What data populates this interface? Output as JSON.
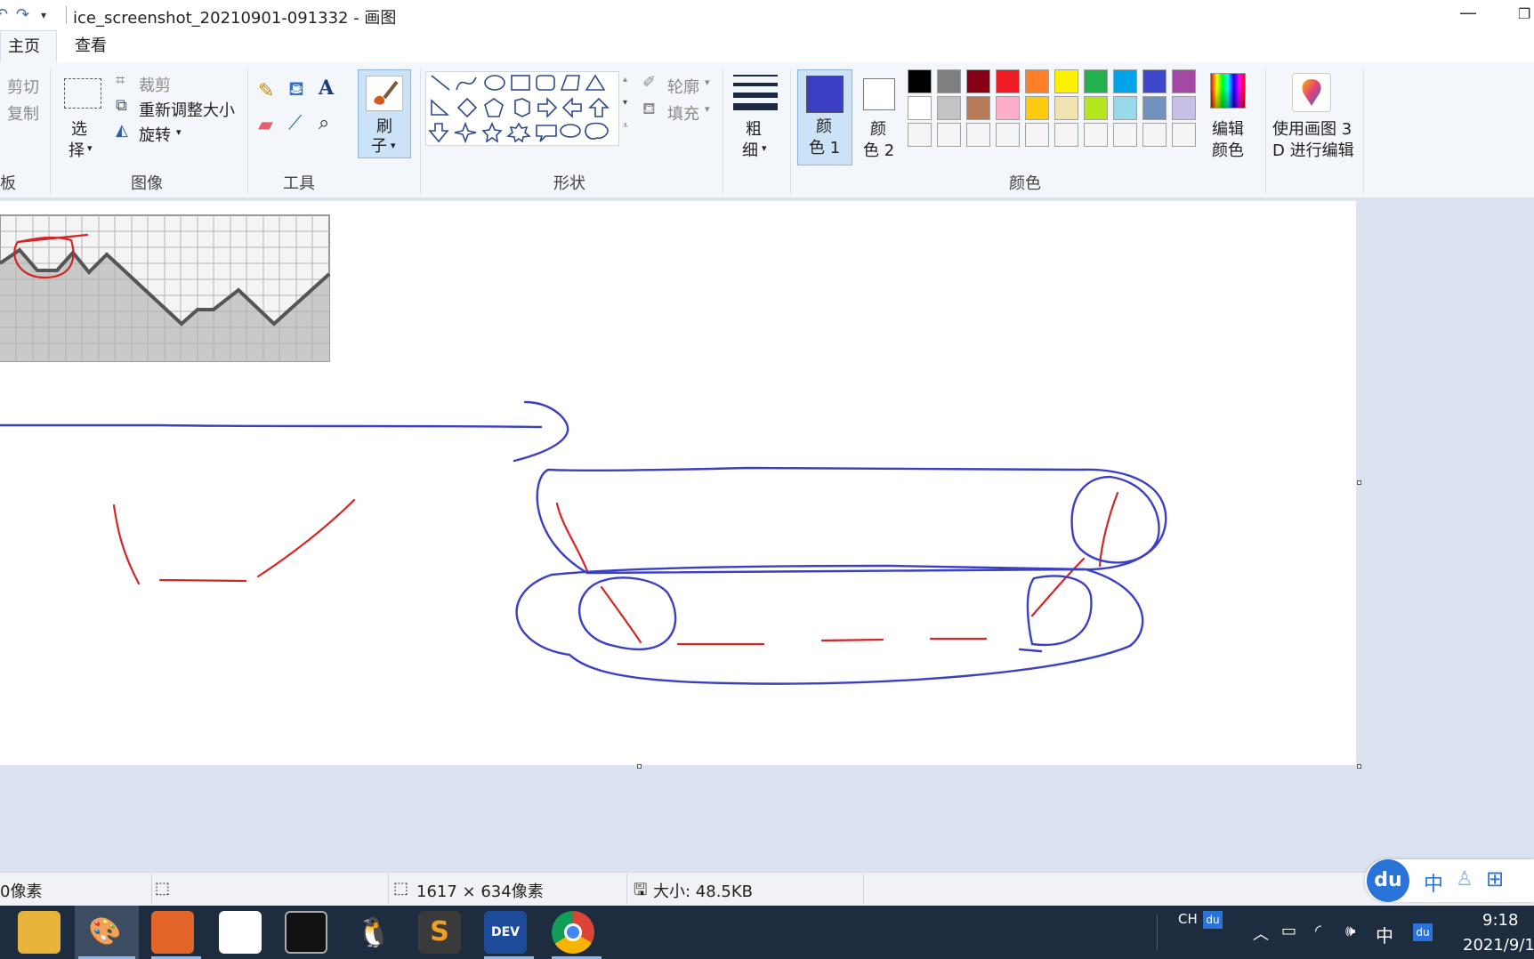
{
  "titlebar": {
    "title": "ice_screenshot_20210901-091332 - 画图"
  },
  "tabs": [
    {
      "label": "主页"
    },
    {
      "label": "查看"
    }
  ],
  "clipboard": {
    "cut": "剪切",
    "copy": "复制",
    "group_label": "板"
  },
  "image": {
    "select_label_1": "选",
    "select_label_2": "择",
    "crop": "裁剪",
    "resize": "重新调整大小",
    "rotate": "旋转",
    "group_label": "图像"
  },
  "tools": {
    "group_label": "工具"
  },
  "brush": {
    "label_1": "刷",
    "label_2": "子"
  },
  "shapes": {
    "outline": "轮廓",
    "fill": "填充",
    "group_label": "形状"
  },
  "size": {
    "label_1": "粗",
    "label_2": "细"
  },
  "colors": {
    "color1_label_1": "颜",
    "color1_label_2": "色 1",
    "color2_label_1": "颜",
    "color2_label_2": "色 2",
    "edit_1": "编辑",
    "edit_2": "颜色",
    "group_label": "颜色",
    "color1_value": "#3a3fc4",
    "color2_value": "#ffffff",
    "palette_row1": [
      "#000000",
      "#7f7f7f",
      "#880015",
      "#ed1c24",
      "#ff7f27",
      "#fff200",
      "#22b14c",
      "#00a2e8",
      "#3f48cc",
      "#a349a4"
    ],
    "palette_row2": [
      "#ffffff",
      "#c3c3c3",
      "#b97a57",
      "#ffaec9",
      "#ffc90e",
      "#efe4b0",
      "#b5e61d",
      "#99d9ea",
      "#7092be",
      "#c8bfe7"
    ],
    "palette_row3": [
      "#f5f5f5",
      "#f5f5f5",
      "#f5f5f5",
      "#f5f5f5",
      "#f5f5f5",
      "#f5f5f5",
      "#f5f5f5",
      "#f5f5f5",
      "#f5f5f5",
      "#f5f5f5"
    ]
  },
  "paint3d": {
    "label_1": "使用画图 3",
    "label_2": "D 进行编辑"
  },
  "status": {
    "cursor_pos": "0像素",
    "canvas_size": "1617 × 634像素",
    "file_size": "大小: 48.5KB"
  },
  "taskbar": {
    "ime_top": "CH",
    "ime_lang": "中",
    "time": "9:18",
    "date": "2021/9/1",
    "floating_ime": "中"
  }
}
